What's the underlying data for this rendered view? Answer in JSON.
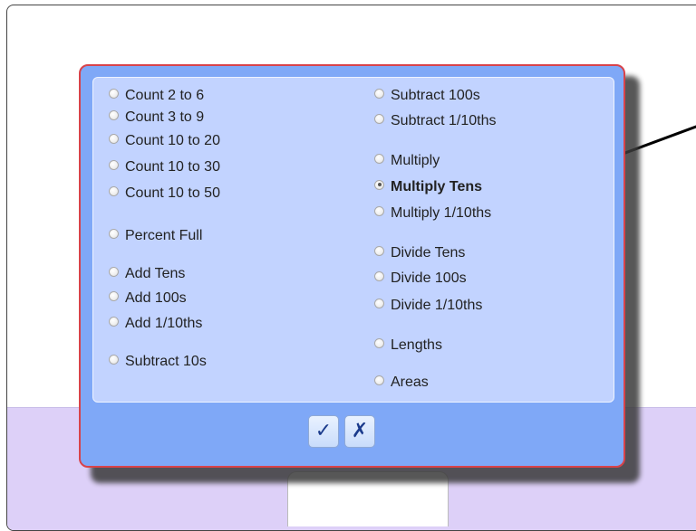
{
  "options_left": [
    {
      "label": "Count 2 to 6",
      "selected": false
    },
    {
      "label": "Count 3 to 9",
      "selected": false
    },
    {
      "label": "Count 10 to 20",
      "selected": false
    },
    {
      "label": "Count 10 to 30",
      "selected": false
    },
    {
      "label": "Count 10 to 50",
      "selected": false
    },
    {
      "label": "Percent Full",
      "selected": false
    },
    {
      "label": "Add Tens",
      "selected": false
    },
    {
      "label": "Add 100s",
      "selected": false
    },
    {
      "label": "Add 1/10ths",
      "selected": false
    },
    {
      "label": "Subtract 10s",
      "selected": false
    }
  ],
  "options_right": [
    {
      "label": "Subtract 100s",
      "selected": false
    },
    {
      "label": "Subtract 1/10ths",
      "selected": false
    },
    {
      "label": "Multiply",
      "selected": false
    },
    {
      "label": "Multiply Tens",
      "selected": true
    },
    {
      "label": "Multiply 1/10ths",
      "selected": false
    },
    {
      "label": "Divide Tens",
      "selected": false
    },
    {
      "label": "Divide 100s",
      "selected": false
    },
    {
      "label": "Divide 1/10ths",
      "selected": false
    },
    {
      "label": "Lengths",
      "selected": false
    },
    {
      "label": "Areas",
      "selected": false
    }
  ],
  "buttons": {
    "ok_icon": "checkmark-icon",
    "ok_glyph": "✓",
    "cancel_icon": "x-icon",
    "cancel_glyph": "✗"
  },
  "colors": {
    "dialog_bg": "#7fa8f7",
    "panel_bg": "#c2d3ff",
    "dialog_border": "#d8434a",
    "page_band": "#ddd0f8"
  }
}
